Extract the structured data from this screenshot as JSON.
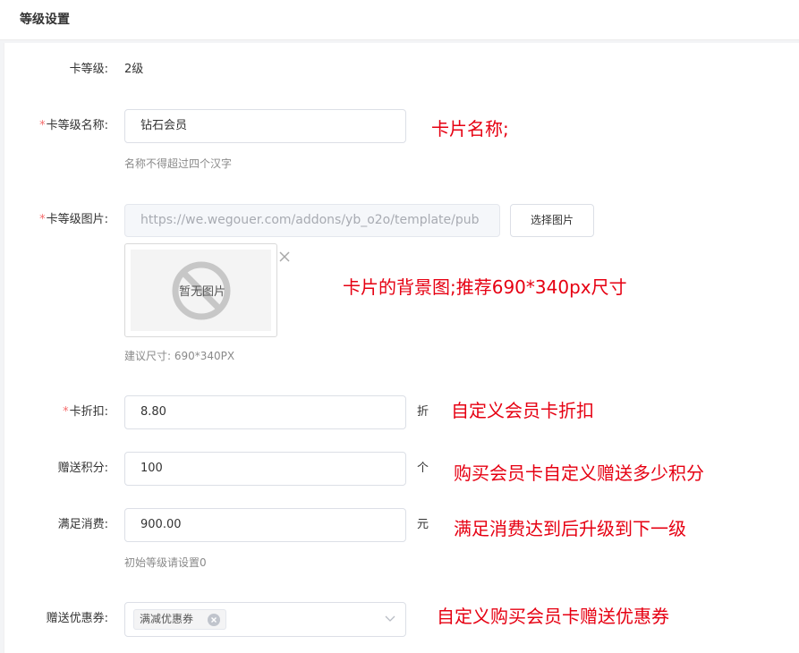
{
  "header": {
    "title": "等级设置"
  },
  "form": {
    "card_level": {
      "label": "卡等级:",
      "value": "2级"
    },
    "card_name": {
      "required_mark": "*",
      "label": "卡等级名称:",
      "value": "钻石会员",
      "help": "名称不得超过四个汉字",
      "note": "卡片名称;"
    },
    "card_image": {
      "required_mark": "*",
      "label": "卡等级图片:",
      "url": "https://we.wegouer.com/addons/yb_o2o/template/pub",
      "button_label": "选择图片",
      "placeholder_text": "暂无图片",
      "size_help": "建议尺寸: 690*340PX",
      "note": "卡片的背景图;推荐690*340px尺寸",
      "icons": {
        "empty_image": "no-image-icon",
        "remove": "close-icon"
      }
    },
    "discount": {
      "required_mark": "*",
      "label": "卡折扣:",
      "value": "8.80",
      "suffix": "折",
      "note": "自定义会员卡折扣"
    },
    "points": {
      "label": "赠送积分:",
      "value": "100",
      "suffix": "个",
      "note": "购买会员卡自定义赠送多少积分"
    },
    "spend_threshold": {
      "label": "满足消费:",
      "value": "900.00",
      "suffix": "元",
      "help": "初始等级请设置0",
      "note": "满足消费达到后升级到下一级"
    },
    "coupons": {
      "label": "赠送优惠券:",
      "selected": "满减优惠券",
      "note": "自定义购买会员卡赠送优惠券",
      "icons": {
        "tag_remove": "circle-close-icon",
        "dropdown": "chevron-down-icon"
      }
    }
  },
  "colors": {
    "required": "#f56c6c",
    "note": "#e60012",
    "border": "#dcdfe6",
    "disabled_bg": "#f5f7fa"
  }
}
